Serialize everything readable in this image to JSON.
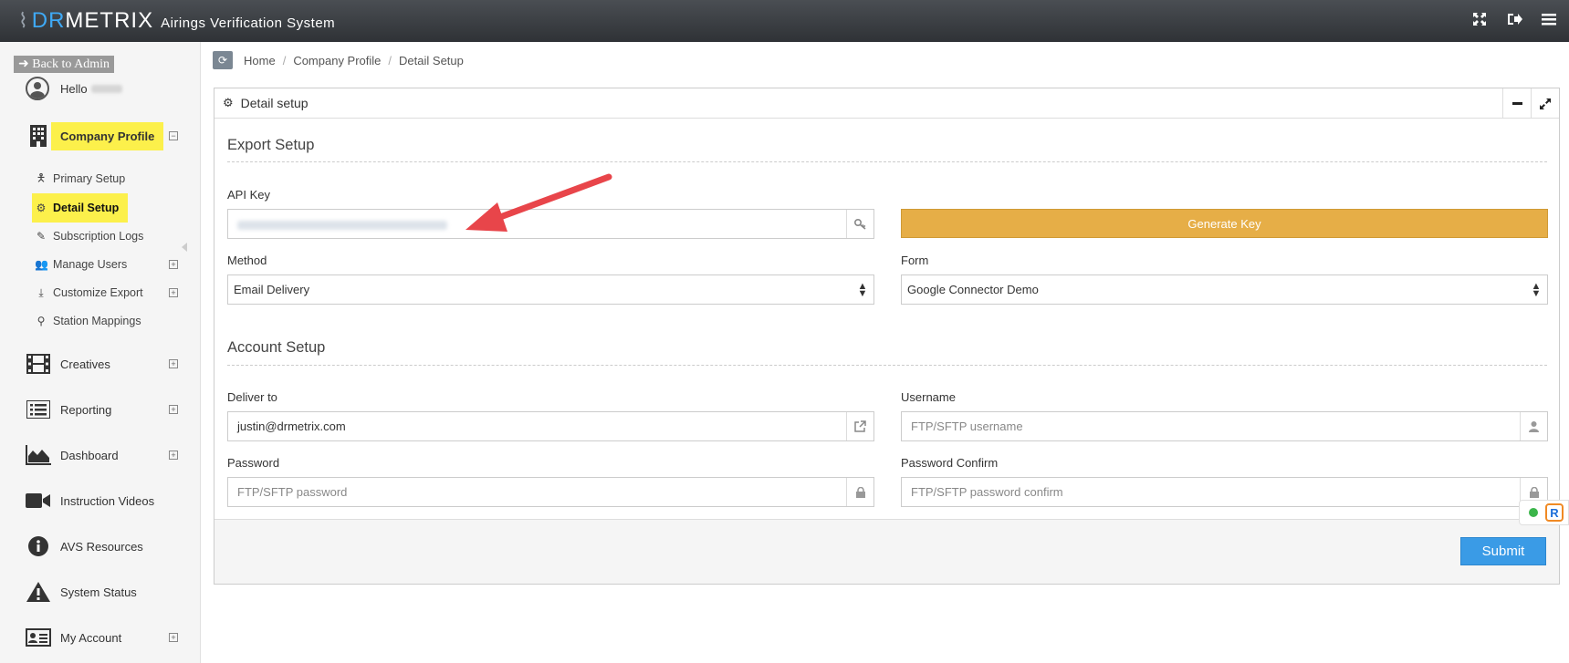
{
  "app": {
    "logo_dr": "DR",
    "logo_metrix": "METRIX",
    "subtitle": "Airings Verification System"
  },
  "topbar": {
    "icons": [
      "fullscreen-icon",
      "logout-icon",
      "menu-icon"
    ]
  },
  "sidebar": {
    "back_to_admin": "Back to Admin",
    "hello": "Hello",
    "company_profile": "Company Profile",
    "sub_items": {
      "primary_setup": "Primary Setup",
      "detail_setup": "Detail Setup",
      "subscription_logs": "Subscription Logs",
      "manage_users": "Manage Users",
      "customize_export": "Customize Export",
      "station_mappings": "Station Mappings"
    },
    "creatives": "Creatives",
    "reporting": "Reporting",
    "dashboard": "Dashboard",
    "instruction_videos": "Instruction Videos",
    "avs_resources": "AVS Resources",
    "system_status": "System Status",
    "my_account": "My Account",
    "highlight_color": "#fcf04b"
  },
  "breadcrumb": {
    "home": "Home",
    "company_profile": "Company Profile",
    "detail_setup": "Detail Setup"
  },
  "panel": {
    "title": "Detail setup",
    "export_setup": {
      "title": "Export Setup",
      "api_key_label": "API Key",
      "generate_key": "Generate Key",
      "method_label": "Method",
      "method_value": "Email Delivery",
      "form_label": "Form",
      "form_value": "Google Connector Demo"
    },
    "account_setup": {
      "title": "Account Setup",
      "deliver_to_label": "Deliver to",
      "deliver_to_value": "justin@drmetrix.com",
      "username_label": "Username",
      "username_placeholder": "FTP/SFTP username",
      "password_label": "Password",
      "password_placeholder": "FTP/SFTP password",
      "password_confirm_label": "Password Confirm",
      "password_confirm_placeholder": "FTP/SFTP password confirm"
    },
    "submit": "Submit"
  },
  "colors": {
    "accent_blue": "#3a9be6",
    "generate_orange": "#e6ae47",
    "arrow_red": "#e8454a"
  }
}
